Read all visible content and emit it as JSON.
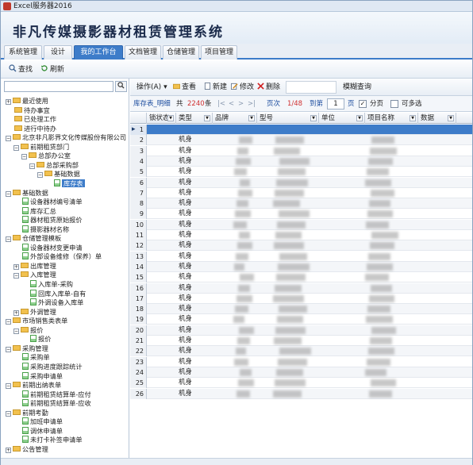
{
  "app": {
    "title": "Excel服务器2016"
  },
  "banner": {
    "title": "非凡传媒摄影器材租赁管理系统"
  },
  "tabs": [
    {
      "label": "系统管理"
    },
    {
      "label": "设计"
    },
    {
      "label": "我的工作台",
      "active": true
    },
    {
      "label": "文档管理"
    },
    {
      "label": "仓储管理"
    },
    {
      "label": "项目管理"
    }
  ],
  "toolbar_left": {
    "find": "查找",
    "refresh": "刷新"
  },
  "toolbar_right": {
    "operate": "操作(A)",
    "view": "查看",
    "new": "新建",
    "edit": "修改",
    "delete": "删除",
    "fuzzy": "模糊查询"
  },
  "pager": {
    "table_name": "库存表_明细",
    "total_prefix": "共",
    "total": "2240",
    "total_suffix": "条",
    "nav_first": "|<",
    "nav_prev": "<",
    "nav_next": ">",
    "nav_last": ">|",
    "page_label": "页次",
    "page_pos": "1/48",
    "goto_label": "到第",
    "goto_value": "1",
    "page_suffix": "页",
    "paging_label": "分页",
    "paging_checked": true,
    "multisel_label": "可多选",
    "multisel_checked": false
  },
  "columns": [
    "锁状态",
    "类型",
    "品牌",
    "型号",
    "单位",
    "项目名称",
    "数据"
  ],
  "rows": [
    {
      "n": "1",
      "type": ""
    },
    {
      "n": "2",
      "type": "机身"
    },
    {
      "n": "3",
      "type": "机身"
    },
    {
      "n": "4",
      "type": "机身"
    },
    {
      "n": "5",
      "type": "机身"
    },
    {
      "n": "6",
      "type": "机身"
    },
    {
      "n": "7",
      "type": "机身"
    },
    {
      "n": "8",
      "type": "机身"
    },
    {
      "n": "9",
      "type": "机身"
    },
    {
      "n": "10",
      "type": "机身"
    },
    {
      "n": "11",
      "type": "机身"
    },
    {
      "n": "12",
      "type": "机身"
    },
    {
      "n": "13",
      "type": "机身"
    },
    {
      "n": "14",
      "type": "机身"
    },
    {
      "n": "15",
      "type": "机身"
    },
    {
      "n": "16",
      "type": "机身"
    },
    {
      "n": "17",
      "type": "机身"
    },
    {
      "n": "18",
      "type": "机身"
    },
    {
      "n": "19",
      "type": "机身"
    },
    {
      "n": "20",
      "type": "机身"
    },
    {
      "n": "21",
      "type": "机身"
    },
    {
      "n": "22",
      "type": "机身"
    },
    {
      "n": "23",
      "type": "机身"
    },
    {
      "n": "24",
      "type": "机身"
    },
    {
      "n": "25",
      "type": "机身"
    },
    {
      "n": "26",
      "type": "机身"
    }
  ],
  "tree": [
    {
      "label": "最近使用",
      "kind": "folder",
      "depth": 0,
      "exp": "+"
    },
    {
      "label": "待办事宜",
      "kind": "folder",
      "depth": 0,
      "exp": ""
    },
    {
      "label": "已处理工作",
      "kind": "folder",
      "depth": 0,
      "exp": ""
    },
    {
      "label": "进行中待办",
      "kind": "folder",
      "depth": 0,
      "exp": ""
    },
    {
      "label": "北京非凡影界文化传媒股份有限公司",
      "kind": "folder",
      "depth": 0,
      "exp": "-"
    },
    {
      "label": "前期租赁部门",
      "kind": "folder",
      "depth": 1,
      "exp": "-"
    },
    {
      "label": "总部办公室",
      "kind": "folder",
      "depth": 2,
      "exp": "-"
    },
    {
      "label": "总部采购部",
      "kind": "folder",
      "depth": 3,
      "exp": "-"
    },
    {
      "label": "基础数据",
      "kind": "folder",
      "depth": 4,
      "exp": "-"
    },
    {
      "label": "库存表",
      "kind": "doc",
      "depth": 5,
      "exp": "",
      "selected": true
    },
    {
      "label": "基础数据",
      "kind": "folder",
      "depth": 0,
      "exp": "-"
    },
    {
      "label": "设备器材编号清单",
      "kind": "doc",
      "depth": 1,
      "exp": ""
    },
    {
      "label": "库存汇总",
      "kind": "doc",
      "depth": 1,
      "exp": ""
    },
    {
      "label": "器材租赁原始报价",
      "kind": "doc",
      "depth": 1,
      "exp": ""
    },
    {
      "label": "摄影器材名称",
      "kind": "doc",
      "depth": 1,
      "exp": ""
    },
    {
      "label": "仓储管理模板",
      "kind": "folder",
      "depth": 0,
      "exp": "-"
    },
    {
      "label": "设备器材变更申请",
      "kind": "doc",
      "depth": 1,
      "exp": ""
    },
    {
      "label": "外部设备维修（保养）单",
      "kind": "doc",
      "depth": 1,
      "exp": ""
    },
    {
      "label": "出库管理",
      "kind": "folder",
      "depth": 1,
      "exp": "+"
    },
    {
      "label": "入库管理",
      "kind": "folder",
      "depth": 1,
      "exp": "-"
    },
    {
      "label": "入库单-采购",
      "kind": "doc",
      "depth": 2,
      "exp": ""
    },
    {
      "label": "回库入库单-自有",
      "kind": "doc",
      "depth": 2,
      "exp": ""
    },
    {
      "label": "外调设备入库单",
      "kind": "doc",
      "depth": 2,
      "exp": ""
    },
    {
      "label": "外调管理",
      "kind": "folder",
      "depth": 1,
      "exp": "+"
    },
    {
      "label": "市场销售类表单",
      "kind": "folder",
      "depth": 0,
      "exp": "-"
    },
    {
      "label": "报价",
      "kind": "folder",
      "depth": 1,
      "exp": "-"
    },
    {
      "label": "报价",
      "kind": "doc",
      "depth": 2,
      "exp": ""
    },
    {
      "label": "采购管理",
      "kind": "folder",
      "depth": 0,
      "exp": "-"
    },
    {
      "label": "采购单",
      "kind": "doc",
      "depth": 1,
      "exp": ""
    },
    {
      "label": "采购进度跟踪统计",
      "kind": "doc",
      "depth": 1,
      "exp": ""
    },
    {
      "label": "采购申请单",
      "kind": "doc",
      "depth": 1,
      "exp": ""
    },
    {
      "label": "前期出纳表单",
      "kind": "folder",
      "depth": 0,
      "exp": "-"
    },
    {
      "label": "前期租赁结算单-应付",
      "kind": "doc",
      "depth": 1,
      "exp": ""
    },
    {
      "label": "前期租赁结算单-应收",
      "kind": "doc",
      "depth": 1,
      "exp": ""
    },
    {
      "label": "前期考勤",
      "kind": "folder",
      "depth": 0,
      "exp": "-"
    },
    {
      "label": "加班申请单",
      "kind": "doc",
      "depth": 1,
      "exp": ""
    },
    {
      "label": "调休申请单",
      "kind": "doc",
      "depth": 1,
      "exp": ""
    },
    {
      "label": "未打卡补签申请单",
      "kind": "doc",
      "depth": 1,
      "exp": ""
    },
    {
      "label": "公告管理",
      "kind": "folder",
      "depth": 0,
      "exp": "+"
    }
  ]
}
